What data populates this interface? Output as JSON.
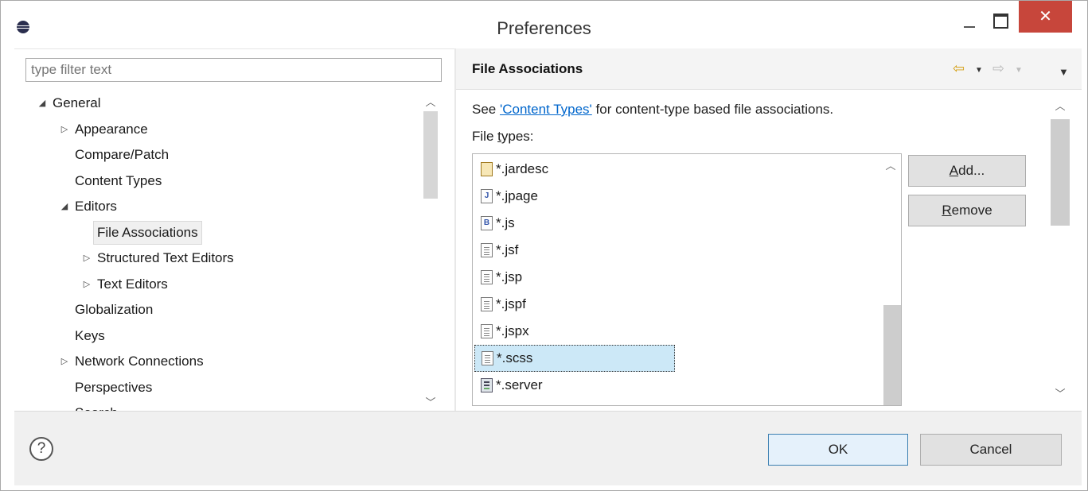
{
  "window": {
    "title": "Preferences",
    "close_glyph": "✕"
  },
  "left": {
    "filter_placeholder": "type filter text",
    "tree": [
      {
        "label": "General",
        "twisty": "◢"
      },
      {
        "label": "Appearance",
        "twisty": "▷"
      },
      {
        "label": "Compare/Patch",
        "twisty": ""
      },
      {
        "label": "Content Types",
        "twisty": ""
      },
      {
        "label": "Editors",
        "twisty": "◢"
      },
      {
        "label": "File Associations",
        "twisty": ""
      },
      {
        "label": "Structured Text Editors",
        "twisty": "▷"
      },
      {
        "label": "Text Editors",
        "twisty": "▷"
      },
      {
        "label": "Globalization",
        "twisty": ""
      },
      {
        "label": "Keys",
        "twisty": ""
      },
      {
        "label": "Network Connections",
        "twisty": "▷"
      },
      {
        "label": "Perspectives",
        "twisty": ""
      },
      {
        "label": "Search",
        "twisty": ""
      }
    ]
  },
  "right": {
    "page_title": "File Associations",
    "nav": {
      "back_icon": "back-arrow-icon",
      "forward_icon": "forward-arrow-icon",
      "menu_icon": "view-menu-icon"
    },
    "link_prefix": "See ",
    "link_text": "'Content Types'",
    "link_suffix": " for content-type based file associations.",
    "file_types_label_pre": "File ",
    "file_types_label_u": "t",
    "file_types_label_post": "ypes:",
    "file_types": [
      {
        "name": "*.jardesc",
        "icon": "jar-icon"
      },
      {
        "name": "*.jpage",
        "icon": "java-page-icon"
      },
      {
        "name": "*.js",
        "icon": "javascript-file-icon"
      },
      {
        "name": "*.jsf",
        "icon": "text-file-icon"
      },
      {
        "name": "*.jsp",
        "icon": "text-file-icon"
      },
      {
        "name": "*.jspf",
        "icon": "text-file-icon"
      },
      {
        "name": "*.jspx",
        "icon": "text-file-icon"
      },
      {
        "name": "*.scss",
        "icon": "text-file-icon"
      },
      {
        "name": "*.server",
        "icon": "server-icon"
      }
    ],
    "selected_file_type": "*.scss",
    "add_pre": "",
    "add_u": "A",
    "add_post": "dd...",
    "remove_pre": "",
    "remove_u": "R",
    "remove_post": "emove"
  },
  "footer": {
    "help_glyph": "?",
    "ok_label": "OK",
    "cancel_label": "Cancel"
  }
}
